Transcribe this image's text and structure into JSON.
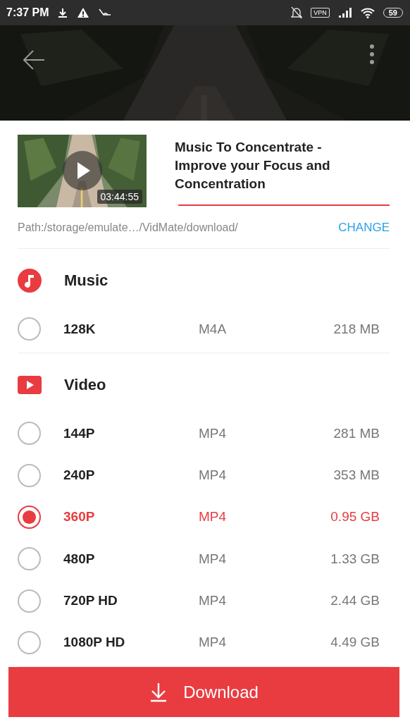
{
  "status_bar": {
    "time": "7:37 PM",
    "vpn": "VPN",
    "battery": "59"
  },
  "video": {
    "duration": "03:44:55",
    "title": "Music To Concentrate - Improve your Focus and Concentration"
  },
  "path": {
    "text": "Path:/storage/emulate…/VidMate/download/",
    "action": "CHANGE"
  },
  "sections": [
    {
      "kind": "music",
      "title": "Music",
      "options": [
        {
          "quality": "128K",
          "format": "M4A",
          "size": "218 MB",
          "selected": false
        }
      ]
    },
    {
      "kind": "video",
      "title": "Video",
      "options": [
        {
          "quality": "144P",
          "format": "MP4",
          "size": "281 MB",
          "selected": false
        },
        {
          "quality": "240P",
          "format": "MP4",
          "size": "353 MB",
          "selected": false
        },
        {
          "quality": "360P",
          "format": "MP4",
          "size": "0.95 GB",
          "selected": true
        },
        {
          "quality": "480P",
          "format": "MP4",
          "size": "1.33 GB",
          "selected": false
        },
        {
          "quality": "720P HD",
          "format": "MP4",
          "size": "2.44 GB",
          "selected": false
        },
        {
          "quality": "1080P HD",
          "format": "MP4",
          "size": "4.49 GB",
          "selected": false
        }
      ]
    }
  ],
  "download_button": "Download"
}
